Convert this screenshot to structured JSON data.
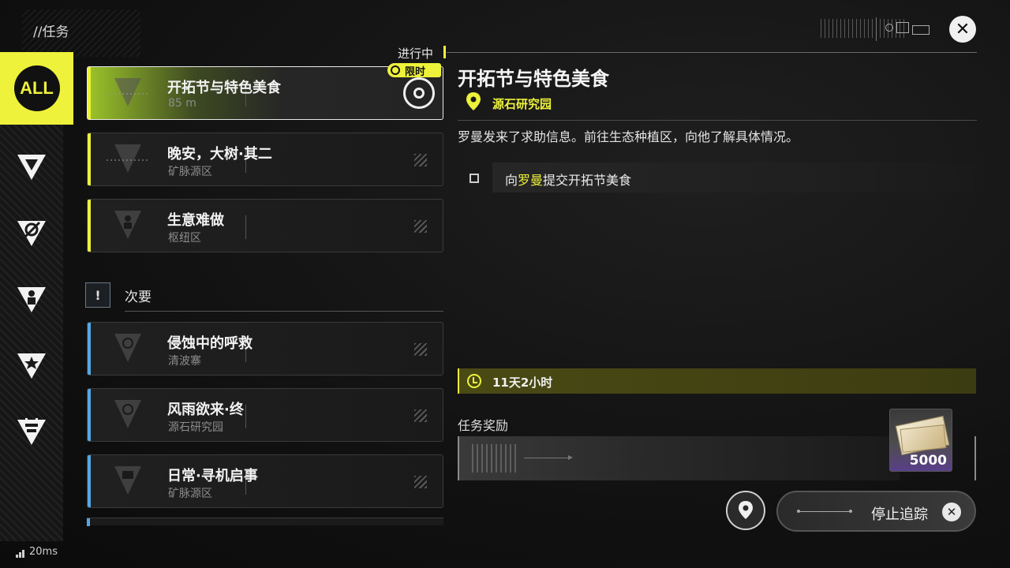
{
  "header": {
    "title": "//任务"
  },
  "colors": {
    "accent": "#eef23a",
    "secondary_accent": "#53a8e6"
  },
  "sidebar": {
    "items": [
      {
        "label": "ALL",
        "icon": "all-badge",
        "active": true
      },
      {
        "label": "ENDFIELD",
        "icon": "endfield-icon"
      },
      {
        "label": "",
        "icon": "pathfinder-icon"
      },
      {
        "label": "",
        "icon": "person-icon"
      },
      {
        "label": "",
        "icon": "star-icon"
      },
      {
        "label": "",
        "icon": "faction-icon"
      }
    ]
  },
  "quests": {
    "in_progress_label": "进行中",
    "limited_label": "限时",
    "main": [
      {
        "title": "开拓节与特色美食",
        "sub": "85 m",
        "selected": true
      },
      {
        "title": "晚安，大树·其二",
        "sub": "矿脉源区"
      },
      {
        "title": "生意难做",
        "sub": "枢纽区"
      }
    ],
    "secondary_icon": "!",
    "secondary_label": "次要",
    "secondary": [
      {
        "title": "侵蚀中的呼救",
        "sub": "清波寨"
      },
      {
        "title": "风雨欲来·终",
        "sub": "源石研究园"
      },
      {
        "title": "日常·寻机启事",
        "sub": "矿脉源区"
      }
    ]
  },
  "detail": {
    "title": "开拓节与特色美食",
    "location": "源石研究园",
    "description": "罗曼发来了求助信息。前往生态种植区，向他了解具体情况。",
    "objective_prefix": "向",
    "objective_highlight": "罗曼",
    "objective_suffix": "提交开拓节美食",
    "timer": "11天2小时",
    "reward_label": "任务奖励",
    "reward_qty": "5000",
    "stop_tracking": "停止追踪"
  },
  "status": {
    "ping": "20ms"
  }
}
